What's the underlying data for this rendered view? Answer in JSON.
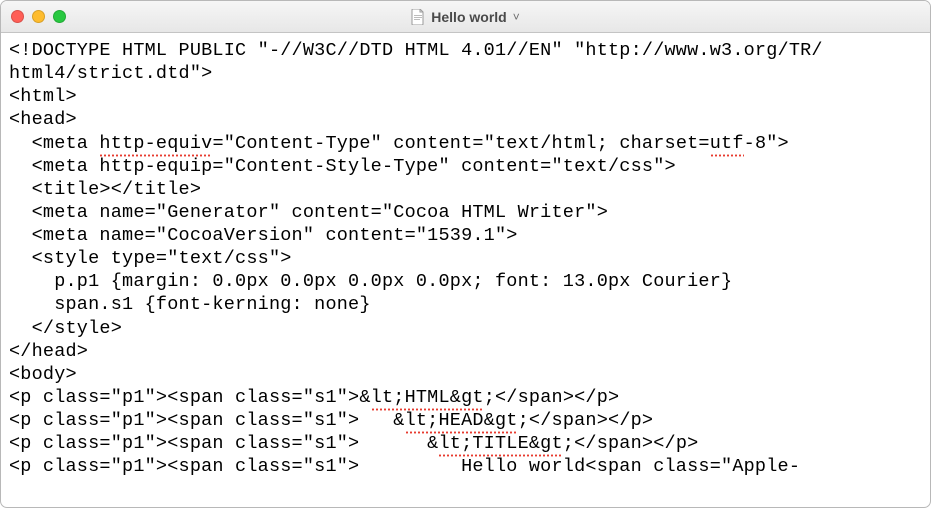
{
  "titlebar": {
    "doc_icon": "document-icon",
    "title": "Hello world",
    "chevron": "˅"
  },
  "code": {
    "line1_a": "<!DOCTYPE HTML PUBLIC \"-//W3C//DTD HTML 4.01//EN\" \"http://www.w3.org/TR/",
    "line2": "html4/strict.dtd\">",
    "line3": "<html>",
    "line4": "<head>",
    "line5_pre": "  <meta ",
    "line5_err": "http-equiv",
    "line5_mid": "=\"Content-Type\" content=\"text/html; charset=",
    "line5_err2": "utf",
    "line5_post": "-8\">",
    "line6": "  <meta http-equip=\"Content-Style-Type\" content=\"text/css\">",
    "line7": "  <title></title>",
    "line8": "  <meta name=\"Generator\" content=\"Cocoa HTML Writer\">",
    "line9": "  <meta name=\"CocoaVersion\" content=\"1539.1\">",
    "line10": "  <style type=\"text/css\">",
    "line11": "    p.p1 {margin: 0.0px 0.0px 0.0px 0.0px; font: 13.0px Courier}",
    "line12": "    span.s1 {font-kerning: none}",
    "line13": "  </style>",
    "line14": "</head>",
    "line15": "<body>",
    "line16_a": "<p class=\"p1\"><span class=\"s1\">&",
    "line16_err": "lt;HTML&gt",
    "line16_b": ";</span></p>",
    "line17_a": "<p class=\"p1\"><span class=\"s1\">   &",
    "line17_err": "lt;HEAD&gt",
    "line17_b": ";</span></p>",
    "line18_a": "<p class=\"p1\"><span class=\"s1\">      &",
    "line18_err": "lt;TITLE&gt",
    "line18_b": ";</span></p>",
    "line19": "<p class=\"p1\"><span class=\"s1\">         Hello world<span class=\"Apple-"
  }
}
